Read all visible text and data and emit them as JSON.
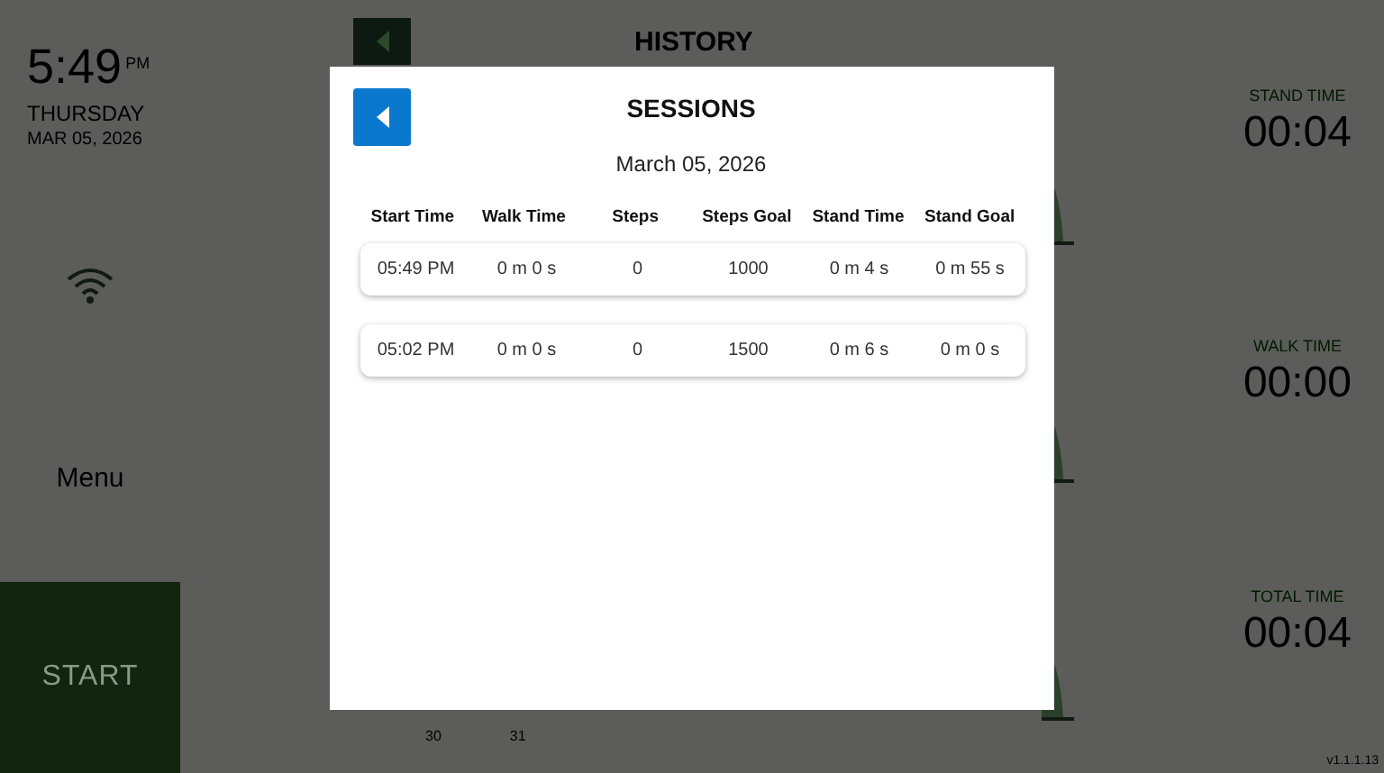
{
  "clock": {
    "time": "5:49",
    "meridiem": "PM",
    "weekday": "THURSDAY",
    "date": "MAR 05, 2026"
  },
  "sidebar": {
    "menu_label": "Menu",
    "start_button": "START"
  },
  "history": {
    "title": "HISTORY",
    "axis_labels": [
      "30",
      "31"
    ]
  },
  "stats": [
    {
      "label": "STAND TIME",
      "value": "00:04"
    },
    {
      "label": "WALK TIME",
      "value": "00:00"
    },
    {
      "label": "TOTAL TIME",
      "value": "00:04"
    }
  ],
  "version": "v1.1.1.13",
  "sessions_dialog": {
    "title": "SESSIONS",
    "date": "March 05, 2026",
    "columns": [
      "Start Time",
      "Walk Time",
      "Steps",
      "Steps Goal",
      "Stand Time",
      "Stand Goal"
    ],
    "rows": [
      [
        "05:49 PM",
        "0 m 0 s",
        "0",
        "1000",
        "0 m 4 s",
        "0 m 55 s"
      ],
      [
        "05:02 PM",
        "0 m 0 s",
        "0",
        "1500",
        "0 m 6 s",
        "0 m 0 s"
      ]
    ]
  }
}
